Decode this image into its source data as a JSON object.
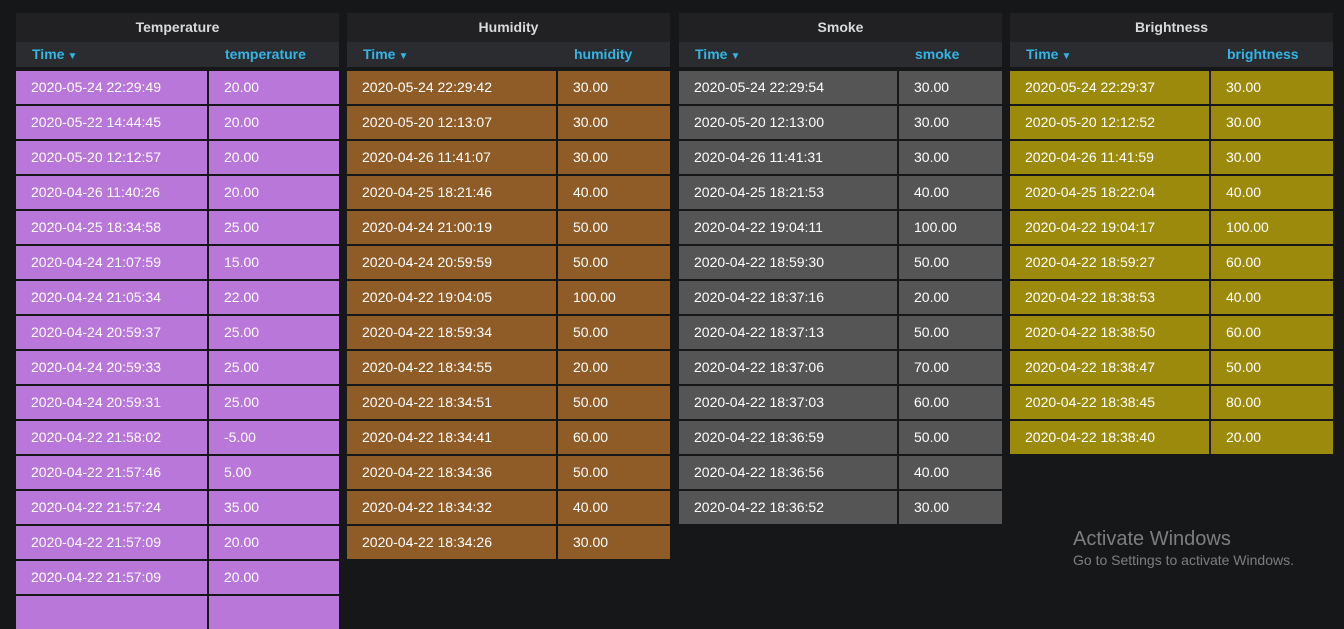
{
  "panels": [
    {
      "title": "Temperature",
      "time_header": "Time",
      "value_header": "temperature",
      "color": "#b877d9",
      "rows": [
        [
          "2020-05-24 22:29:49",
          "20.00"
        ],
        [
          "2020-05-22 14:44:45",
          "20.00"
        ],
        [
          "2020-05-20 12:12:57",
          "20.00"
        ],
        [
          "2020-04-26 11:40:26",
          "20.00"
        ],
        [
          "2020-04-25 18:34:58",
          "25.00"
        ],
        [
          "2020-04-24 21:07:59",
          "15.00"
        ],
        [
          "2020-04-24 21:05:34",
          "22.00"
        ],
        [
          "2020-04-24 20:59:37",
          "25.00"
        ],
        [
          "2020-04-24 20:59:33",
          "25.00"
        ],
        [
          "2020-04-24 20:59:31",
          "25.00"
        ],
        [
          "2020-04-22 21:58:02",
          "-5.00"
        ],
        [
          "2020-04-22 21:57:46",
          "5.00"
        ],
        [
          "2020-04-22 21:57:24",
          "35.00"
        ],
        [
          "2020-04-22 21:57:09",
          "20.00"
        ],
        [
          "2020-04-22 21:57:09",
          "20.00"
        ],
        [
          "",
          ""
        ]
      ]
    },
    {
      "title": "Humidity",
      "time_header": "Time",
      "value_header": "humidity",
      "color": "#8f5c27",
      "rows": [
        [
          "2020-05-24 22:29:42",
          "30.00"
        ],
        [
          "2020-05-20 12:13:07",
          "30.00"
        ],
        [
          "2020-04-26 11:41:07",
          "30.00"
        ],
        [
          "2020-04-25 18:21:46",
          "40.00"
        ],
        [
          "2020-04-24 21:00:19",
          "50.00"
        ],
        [
          "2020-04-24 20:59:59",
          "50.00"
        ],
        [
          "2020-04-22 19:04:05",
          "100.00"
        ],
        [
          "2020-04-22 18:59:34",
          "50.00"
        ],
        [
          "2020-04-22 18:34:55",
          "20.00"
        ],
        [
          "2020-04-22 18:34:51",
          "50.00"
        ],
        [
          "2020-04-22 18:34:41",
          "60.00"
        ],
        [
          "2020-04-22 18:34:36",
          "50.00"
        ],
        [
          "2020-04-22 18:34:32",
          "40.00"
        ],
        [
          "2020-04-22 18:34:26",
          "30.00"
        ]
      ]
    },
    {
      "title": "Smoke",
      "time_header": "Time",
      "value_header": "smoke",
      "color": "#555555",
      "rows": [
        [
          "2020-05-24 22:29:54",
          "30.00"
        ],
        [
          "2020-05-20 12:13:00",
          "30.00"
        ],
        [
          "2020-04-26 11:41:31",
          "30.00"
        ],
        [
          "2020-04-25 18:21:53",
          "40.00"
        ],
        [
          "2020-04-22 19:04:11",
          "100.00"
        ],
        [
          "2020-04-22 18:59:30",
          "50.00"
        ],
        [
          "2020-04-22 18:37:16",
          "20.00"
        ],
        [
          "2020-04-22 18:37:13",
          "50.00"
        ],
        [
          "2020-04-22 18:37:06",
          "70.00"
        ],
        [
          "2020-04-22 18:37:03",
          "60.00"
        ],
        [
          "2020-04-22 18:36:59",
          "50.00"
        ],
        [
          "2020-04-22 18:36:56",
          "40.00"
        ],
        [
          "2020-04-22 18:36:52",
          "30.00"
        ]
      ]
    },
    {
      "title": "Brightness",
      "time_header": "Time",
      "value_header": "brightness",
      "color": "#9c8a0c",
      "rows": [
        [
          "2020-05-24 22:29:37",
          "30.00"
        ],
        [
          "2020-05-20 12:12:52",
          "30.00"
        ],
        [
          "2020-04-26 11:41:59",
          "30.00"
        ],
        [
          "2020-04-25 18:22:04",
          "40.00"
        ],
        [
          "2020-04-22 19:04:17",
          "100.00"
        ],
        [
          "2020-04-22 18:59:27",
          "60.00"
        ],
        [
          "2020-04-22 18:38:53",
          "40.00"
        ],
        [
          "2020-04-22 18:38:50",
          "60.00"
        ],
        [
          "2020-04-22 18:38:47",
          "50.00"
        ],
        [
          "2020-04-22 18:38:45",
          "80.00"
        ],
        [
          "2020-04-22 18:38:40",
          "20.00"
        ]
      ]
    }
  ],
  "sort_icon": "caret-down-icon",
  "watermark": {
    "line1": "Activate Windows",
    "line2": "Go to Settings to activate Windows."
  }
}
